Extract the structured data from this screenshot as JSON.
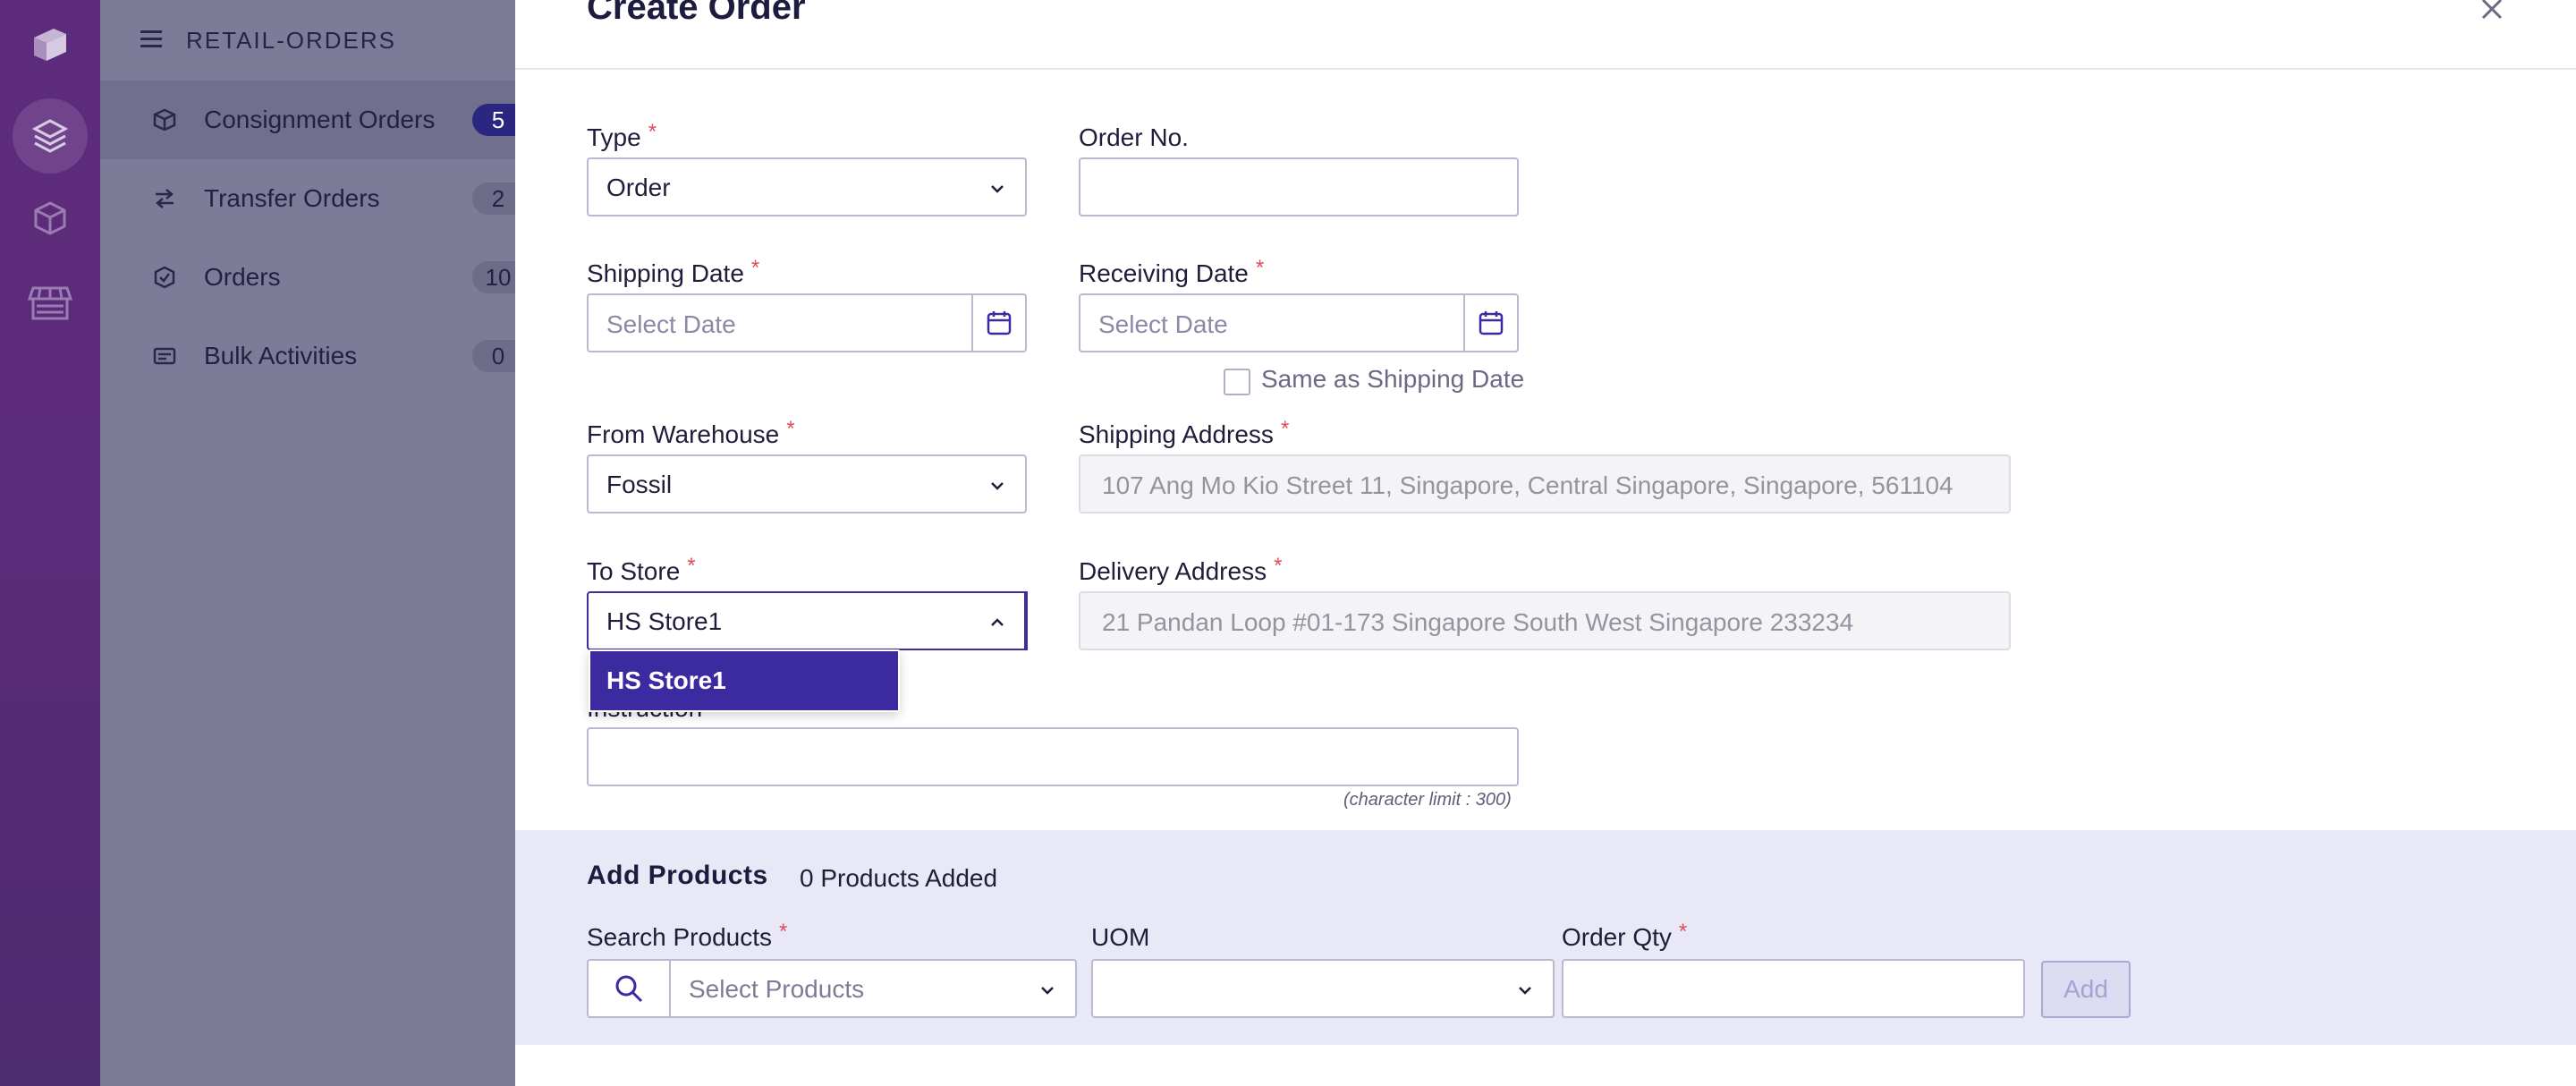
{
  "app": {
    "module_title": "RETAIL-ORDERS"
  },
  "rail": {
    "icons": [
      "logo-icon",
      "layers-icon",
      "box-icon",
      "store-icon"
    ]
  },
  "nav": {
    "items": [
      {
        "label": "Consignment Orders",
        "count": "5",
        "icon": "package-icon"
      },
      {
        "label": "Transfer Orders",
        "count": "2",
        "icon": "transfer-icon"
      },
      {
        "label": "Orders",
        "count": "10",
        "icon": "check-circle-icon"
      },
      {
        "label": "Bulk Activities",
        "count": "0",
        "icon": "list-card-icon"
      }
    ]
  },
  "modal": {
    "title": "Create Order",
    "type": {
      "label": "Type",
      "value": "Order"
    },
    "order_no": {
      "label": "Order No.",
      "value": ""
    },
    "shipping_date": {
      "label": "Shipping Date",
      "placeholder": "Select Date"
    },
    "receiving_date": {
      "label": "Receiving Date",
      "placeholder": "Select Date"
    },
    "same_as_shipping": {
      "label": "Same as Shipping Date",
      "checked": false
    },
    "from_warehouse": {
      "label": "From Warehouse",
      "value": "Fossil"
    },
    "shipping_address": {
      "label": "Shipping Address",
      "value": "107 Ang Mo Kio Street 11, Singapore, Central Singapore, Singapore, 561104"
    },
    "to_store": {
      "label": "To Store",
      "value": "HS Store1",
      "options": [
        "HS Store1"
      ]
    },
    "delivery_address": {
      "label": "Delivery Address",
      "value": "21 Pandan Loop #01-173  Singapore South West Singapore 233234"
    },
    "instruction": {
      "label": "Instruction",
      "value": "",
      "char_limit": "(character limit : 300)"
    }
  },
  "products": {
    "title": "Add Products",
    "count_text": "0 Products Added",
    "search": {
      "label": "Search Products",
      "placeholder": "Select Products"
    },
    "uom": {
      "label": "UOM",
      "value": ""
    },
    "order_qty": {
      "label": "Order Qty",
      "value": ""
    },
    "add_label": "Add"
  },
  "colors": {
    "primary": "#3b2aa0",
    "required": "#e04b5a",
    "rail": "#5d2b7c",
    "products_band": "#e9e8f6"
  }
}
